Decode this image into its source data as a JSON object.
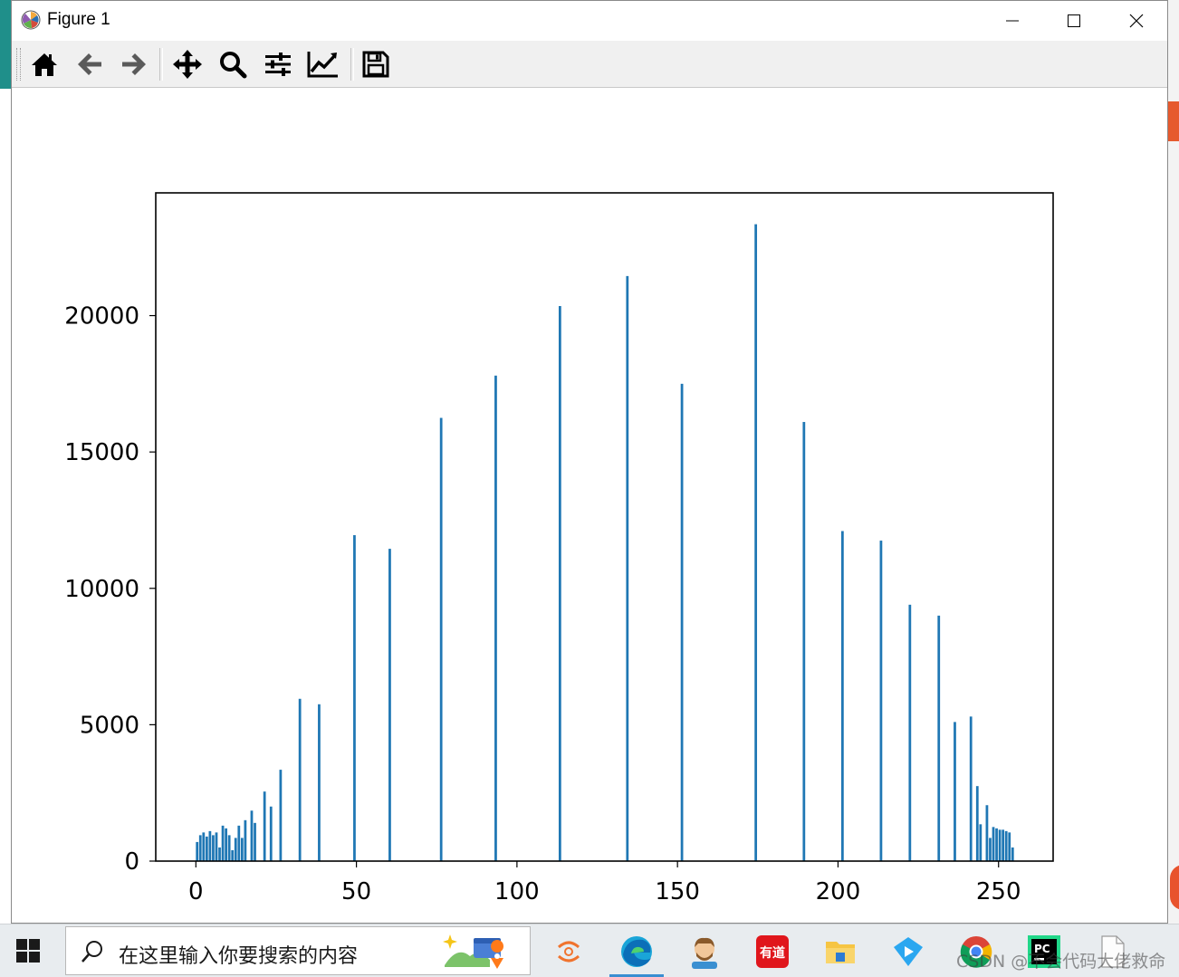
{
  "window": {
    "title": "Figure 1"
  },
  "toolbar": {
    "buttons": [
      "home-icon",
      "back-arrow-icon",
      "forward-arrow-icon",
      "pan-icon",
      "zoom-icon",
      "configure-subplots-icon",
      "edit-axis-icon",
      "save-icon"
    ]
  },
  "taskbar": {
    "search_placeholder": "在这里输入你要搜索的内容",
    "apps": [
      "app-orange-icon",
      "edge-icon",
      "avatar-app-icon",
      "youdao-icon",
      "file-explorer-icon",
      "video-app-icon",
      "chrome-icon",
      "pycharm-icon",
      "document-icon"
    ],
    "youdao_text": "有道",
    "pycharm_text": "PC"
  },
  "watermark": "CSDN @不会代码大佬救命",
  "colors": {
    "bar": "#1f77b4",
    "titlebar": "#ffffff",
    "toolbar": "#f0f0f0"
  },
  "chart_data": {
    "type": "bar",
    "title": "",
    "xlabel": "",
    "ylabel": "",
    "xlim": [
      -12.5,
      267
    ],
    "ylim": [
      0,
      24500
    ],
    "xticks": [
      0,
      50,
      100,
      150,
      200,
      250
    ],
    "yticks": [
      0,
      5000,
      10000,
      15000,
      20000
    ],
    "tick_labels_x": [
      "0",
      "50",
      "100",
      "150",
      "200",
      "250"
    ],
    "tick_labels_y": [
      "0",
      "5000",
      "10000",
      "15000",
      "20000"
    ],
    "grid": false,
    "legend": "none",
    "bins": [
      {
        "x": 0,
        "y": 700
      },
      {
        "x": 1,
        "y": 950
      },
      {
        "x": 2,
        "y": 1050
      },
      {
        "x": 3,
        "y": 900
      },
      {
        "x": 4,
        "y": 1100
      },
      {
        "x": 5,
        "y": 950
      },
      {
        "x": 6,
        "y": 1050
      },
      {
        "x": 7,
        "y": 500
      },
      {
        "x": 8,
        "y": 1300
      },
      {
        "x": 9,
        "y": 1200
      },
      {
        "x": 10,
        "y": 950
      },
      {
        "x": 11,
        "y": 400
      },
      {
        "x": 12,
        "y": 850
      },
      {
        "x": 13,
        "y": 1300
      },
      {
        "x": 14,
        "y": 850
      },
      {
        "x": 15,
        "y": 1500
      },
      {
        "x": 17,
        "y": 1850
      },
      {
        "x": 18,
        "y": 1400
      },
      {
        "x": 21,
        "y": 2550
      },
      {
        "x": 23,
        "y": 2000
      },
      {
        "x": 26,
        "y": 3350
      },
      {
        "x": 32,
        "y": 5950
      },
      {
        "x": 38,
        "y": 5750
      },
      {
        "x": 49,
        "y": 11950
      },
      {
        "x": 60,
        "y": 11450
      },
      {
        "x": 76,
        "y": 16250
      },
      {
        "x": 93,
        "y": 17800
      },
      {
        "x": 113,
        "y": 20350
      },
      {
        "x": 134,
        "y": 21450
      },
      {
        "x": 151,
        "y": 17500
      },
      {
        "x": 174,
        "y": 23350
      },
      {
        "x": 189,
        "y": 16100
      },
      {
        "x": 201,
        "y": 12100
      },
      {
        "x": 213,
        "y": 11750
      },
      {
        "x": 222,
        "y": 9400
      },
      {
        "x": 231,
        "y": 9000
      },
      {
        "x": 236,
        "y": 5100
      },
      {
        "x": 241,
        "y": 5300
      },
      {
        "x": 243,
        "y": 2750
      },
      {
        "x": 244,
        "y": 1350
      },
      {
        "x": 246,
        "y": 2050
      },
      {
        "x": 247,
        "y": 850
      },
      {
        "x": 248,
        "y": 1250
      },
      {
        "x": 249,
        "y": 1200
      },
      {
        "x": 250,
        "y": 1150
      },
      {
        "x": 251,
        "y": 1150
      },
      {
        "x": 252,
        "y": 1100
      },
      {
        "x": 253,
        "y": 1050
      },
      {
        "x": 254,
        "y": 500
      }
    ]
  }
}
